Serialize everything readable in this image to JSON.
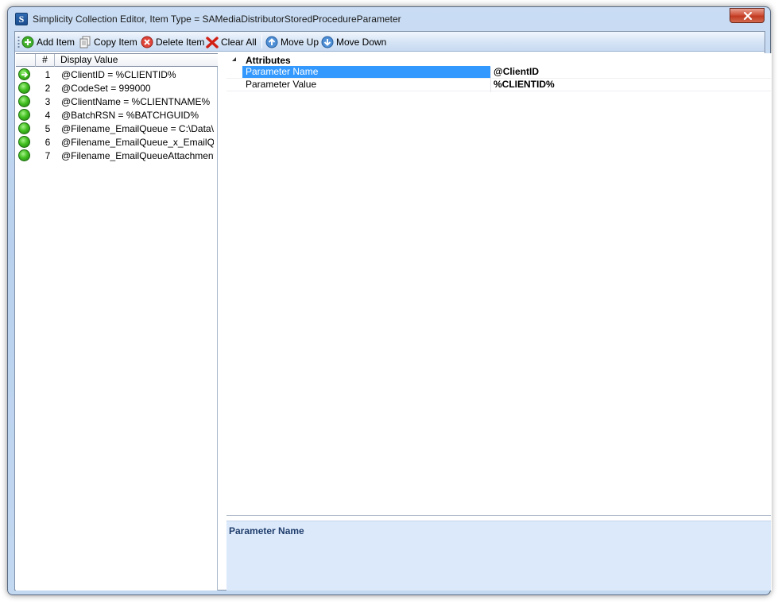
{
  "window": {
    "title": "Simplicity Collection Editor, Item Type = SAMediaDistributorStoredProcedureParameter",
    "app_icon_letter": "S"
  },
  "toolbar": {
    "add_label": "Add Item",
    "copy_label": "Copy Item",
    "delete_label": "Delete Item",
    "clear_label": "Clear All",
    "move_up_label": "Move Up",
    "move_down_label": "Move Down"
  },
  "list": {
    "columns": [
      "",
      "#",
      "Display Value"
    ],
    "items": [
      {
        "num": "1",
        "value": "@ClientID = %CLIENTID%",
        "current": true
      },
      {
        "num": "2",
        "value": "@CodeSet = 999000",
        "current": false
      },
      {
        "num": "3",
        "value": "@ClientName = %CLIENTNAME%",
        "current": false
      },
      {
        "num": "4",
        "value": "@BatchRSN = %BATCHGUID%",
        "current": false
      },
      {
        "num": "5",
        "value": "@Filename_EmailQueue = C:\\Data\\U...",
        "current": false
      },
      {
        "num": "6",
        "value": "@Filename_EmailQueue_x_EmailQue...",
        "current": false
      },
      {
        "num": "7",
        "value": "@Filename_EmailQueueAttachment =...",
        "current": false
      }
    ]
  },
  "properties": {
    "category": "Attributes",
    "rows": [
      {
        "name": "Parameter Name",
        "value": "@ClientID",
        "selected": true
      },
      {
        "name": "Parameter Value",
        "value": "%CLIENTID%",
        "selected": false
      }
    ]
  },
  "description": {
    "title": "Parameter Name"
  },
  "colors": {
    "selection": "#3399ff",
    "description_bg": "#dce9fb",
    "status_green": "#43c021"
  },
  "icons": [
    "app-icon",
    "close-icon",
    "add-icon",
    "copy-icon",
    "delete-icon",
    "clear-icon",
    "move-up-icon",
    "move-down-icon",
    "status-icon",
    "arrow-right-icon"
  ]
}
